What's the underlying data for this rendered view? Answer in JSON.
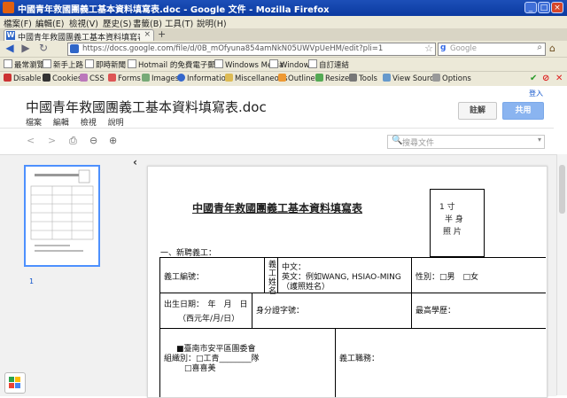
{
  "window": {
    "title": "中國青年救國團義工基本資料填寫表.doc - Google 文件 - Mozilla Firefox",
    "minimize": "_",
    "maximize": "□",
    "close": "×"
  },
  "menubar": {
    "items": [
      "檔案(F)",
      "編輯(E)",
      "檢視(V)",
      "歷史(S)",
      "書籤(B)",
      "工具(T)",
      "說明(H)"
    ]
  },
  "tabs": {
    "active_label": "中國青年救國團義工基本資料填寫表.do...",
    "close": "×",
    "new_tab": "+"
  },
  "navbar": {
    "back": "◀",
    "forward": "▶",
    "reload": "↻",
    "url": "https://docs.google.com/file/d/0B_mOfyuna854amNkN05UWVpUeHM/edit?pli=1",
    "search_placeholder": "Google",
    "search_logo": "g",
    "home": "⌂",
    "bookmark_star": "☆",
    "search_icon": "⌕"
  },
  "bookmarks": [
    "最常瀏覽",
    "新手上路",
    "即時新聞",
    "Hotmail 的免費電子郵件",
    "Windows Media",
    "Windows",
    "自訂連結"
  ],
  "devbar": {
    "items": [
      "Disable",
      "Cookies",
      "CSS",
      "Forms",
      "Images",
      "Information",
      "Miscellaneous",
      "Outline",
      "Resize",
      "Tools",
      "View Source",
      "Options"
    ],
    "check": "✔",
    "stop": "⊘",
    "close": "✕"
  },
  "doc": {
    "login": "登入",
    "title": "中國青年救國團義工基本資料填寫表.doc",
    "menu": [
      "檔案",
      "編輯",
      "檢視",
      "說明"
    ],
    "comment_button": "註解",
    "share_button": "共用",
    "toolbar": {
      "prev": "<",
      "next": ">",
      "print": "⎙",
      "zoom_out": "⊖",
      "zoom_in": "⊕"
    },
    "search_placeholder": "搜尋文件",
    "search_icon": "🔍",
    "search_caret": "▾",
    "collapse": "‹",
    "page_number": "1"
  },
  "form": {
    "title": "中國青年救國團義工基本資料填寫表",
    "photo": [
      "1  寸",
      "半 身",
      "照 片"
    ],
    "section1": "一、新聘義工：",
    "volunteer_no": "義工編號：",
    "name_vertical": [
      "義",
      "工",
      "姓",
      "名"
    ],
    "chinese_name": "中文：",
    "english_name": "英文：例如WANG, HSIAO-MING",
    "english_note": "（護照姓名）",
    "gender": "性別：□男　□女",
    "birthday": "出生日期：　年　月　日",
    "birthday_note": "（西元年/月/日）",
    "id_no": "身分證字號：",
    "education": "最高學歷：",
    "org_line1": "■臺南市安平區團委會",
    "org_line2": "組織別：□工青________隊",
    "org_line3": "□喜喜美",
    "position": "義工職務："
  }
}
